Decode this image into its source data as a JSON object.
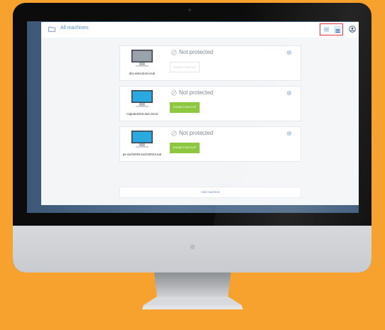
{
  "header": {
    "title": "All machines"
  },
  "machines": [
    {
      "name": "dns.wind.dom.local",
      "status": "Not protected",
      "backup_label": "ENABLE BACKUP",
      "backup_enabled": false
    },
    {
      "name": "migrate2016.dom.local",
      "status": "Not protected",
      "backup_label": "ENABLE BACKUP",
      "backup_enabled": true
    },
    {
      "name": "pe-ssch2003.ssch2003.local",
      "status": "Not protected",
      "backup_label": "ENABLE BACKUP",
      "backup_enabled": true
    }
  ],
  "add_machine_label": "Add machine",
  "colors": {
    "background": "#f7a12f",
    "accent_green": "#8dc63f",
    "highlight_red": "#e0212b",
    "link_blue": "#5b8fc7"
  },
  "icons": {
    "folder": "folder-icon",
    "list_view": "list-view-icon",
    "grid_view": "grid-view-icon",
    "account": "account-icon",
    "shield": "shield-icon",
    "settings": "gear-icon"
  }
}
